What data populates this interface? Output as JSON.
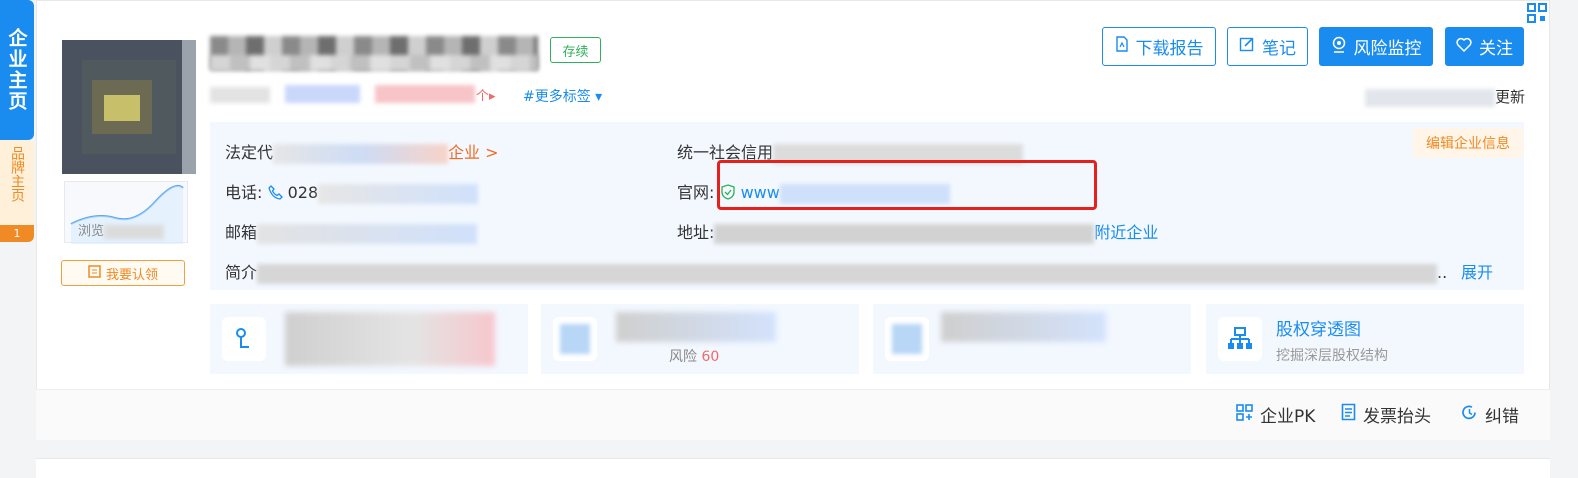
{
  "sidebar": {
    "main_tab": "企业主页",
    "brand_tab": "品牌主页",
    "brand_badge": "1"
  },
  "company": {
    "status": "存续",
    "more_tags": "#更多标签",
    "tag_suffix": "个",
    "update_suffix": "更新",
    "browse_label": "浏览",
    "claim_button": "我要认领"
  },
  "actions": {
    "download_report": "下载报告",
    "notes": "笔记",
    "risk_monitor": "风险监控",
    "follow": "关注"
  },
  "info": {
    "legal_rep_label": "法定代",
    "legal_rep_link": "企业 >",
    "phone_label": "电话:",
    "phone_value": "028",
    "email_label": "邮箱",
    "intro_label": "简介",
    "credit_code_label": "统一社会信用",
    "website_label": "官网:",
    "website_value": "www",
    "address_label": "地址:",
    "nearby_link": "附近企业",
    "expand_link": "展开",
    "intro_ellipsis": "..",
    "edit_button": "编辑企业信息"
  },
  "stats": {
    "card2_risk_label": "风险",
    "card2_risk_value": "60",
    "equity_title": "股权穿透图",
    "equity_subtitle": "挖掘深层股权结构"
  },
  "footer": {
    "pk": "企业PK",
    "invoice": "发票抬头",
    "correction": "纠错"
  },
  "colors": {
    "accent": "#1a8cf0",
    "highlight_box": "#e8201c",
    "orange": "#f08a24",
    "status_green": "#2fb05a"
  }
}
